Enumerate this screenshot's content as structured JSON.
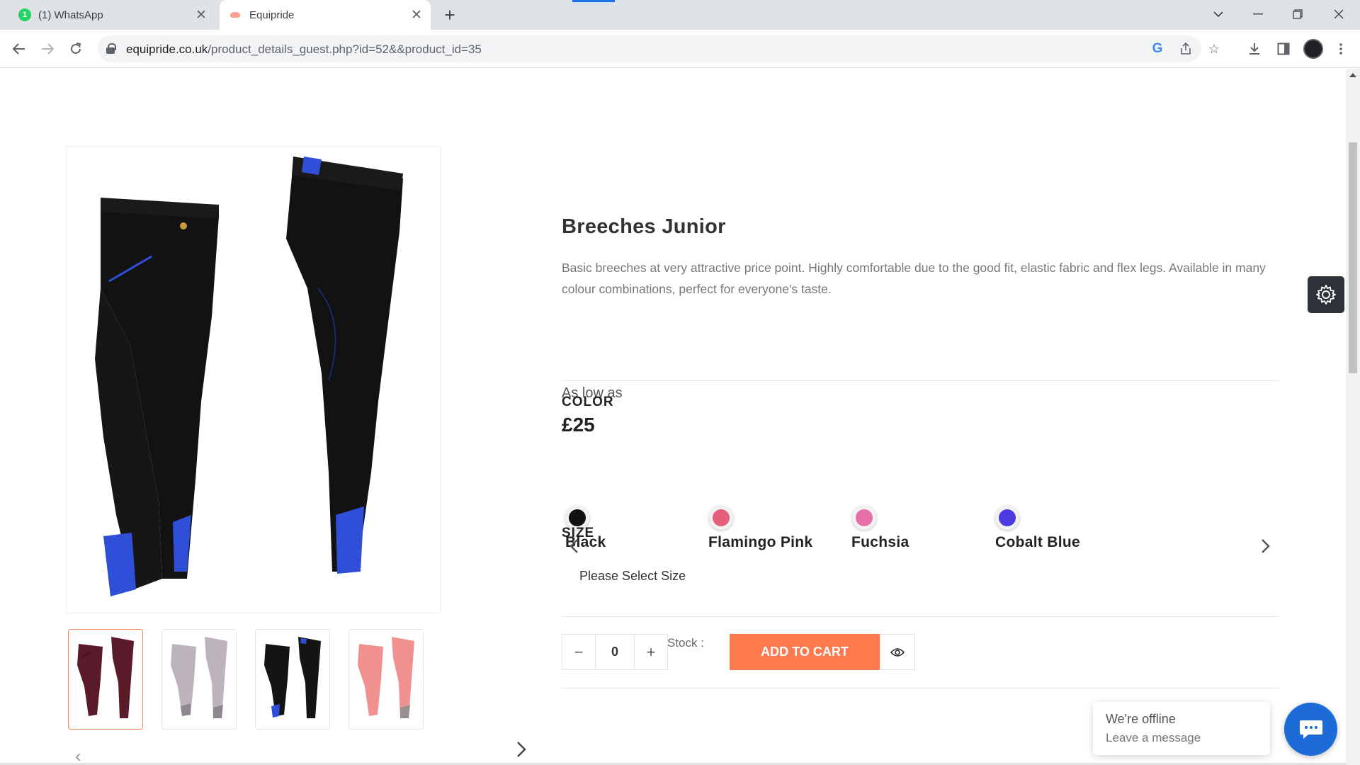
{
  "browser": {
    "tabs": [
      {
        "title": "(1) WhatsApp",
        "badge": "1",
        "active": false
      },
      {
        "title": "Equipride",
        "active": true
      }
    ],
    "url_domain": "equipride.co.uk",
    "url_path": "/product_details_guest.php?id=52&&product_id=35"
  },
  "product": {
    "title": "Breeches Junior",
    "description": "Basic breeches at very attractive price point. Highly comfortable due to the good fit, elastic fabric and flex legs. Available in many colour combinations, perfect for everyone's taste.",
    "price_label": "As low as",
    "price": "£25",
    "color_label": "COLOR",
    "colors": [
      {
        "name": "Black",
        "hex": "#111111"
      },
      {
        "name": "Flamingo Pink",
        "hex": "#e4607a"
      },
      {
        "name": "Fuchsia",
        "hex": "#e76fa7"
      },
      {
        "name": "Cobalt Blue",
        "hex": "#4b3be0"
      }
    ],
    "size_label": "SIZE",
    "size_placeholder": "Please Select Size",
    "quantity": "0",
    "stock_label": "Stock :",
    "add_to_cart": "ADD TO CART",
    "thumbnails": [
      {
        "variant": "burgundy",
        "fabric": "#5b1a2a",
        "patch": "#4a1020",
        "selected": true
      },
      {
        "variant": "grey",
        "fabric": "#bdb3bd",
        "patch": "#8e8790",
        "selected": false
      },
      {
        "variant": "black-blue",
        "fabric": "#141414",
        "patch": "#2f4fd8",
        "selected": false
      },
      {
        "variant": "pink",
        "fabric": "#f0918f",
        "patch": "#9a9090",
        "selected": false
      }
    ]
  },
  "chat": {
    "status": "We're offline",
    "prompt": "Leave a message"
  },
  "colors": {
    "accent": "#fc7a4e",
    "chat_blue": "#1c6bd6",
    "main_fabric": "#121212",
    "main_patch": "#2f4fd8"
  }
}
